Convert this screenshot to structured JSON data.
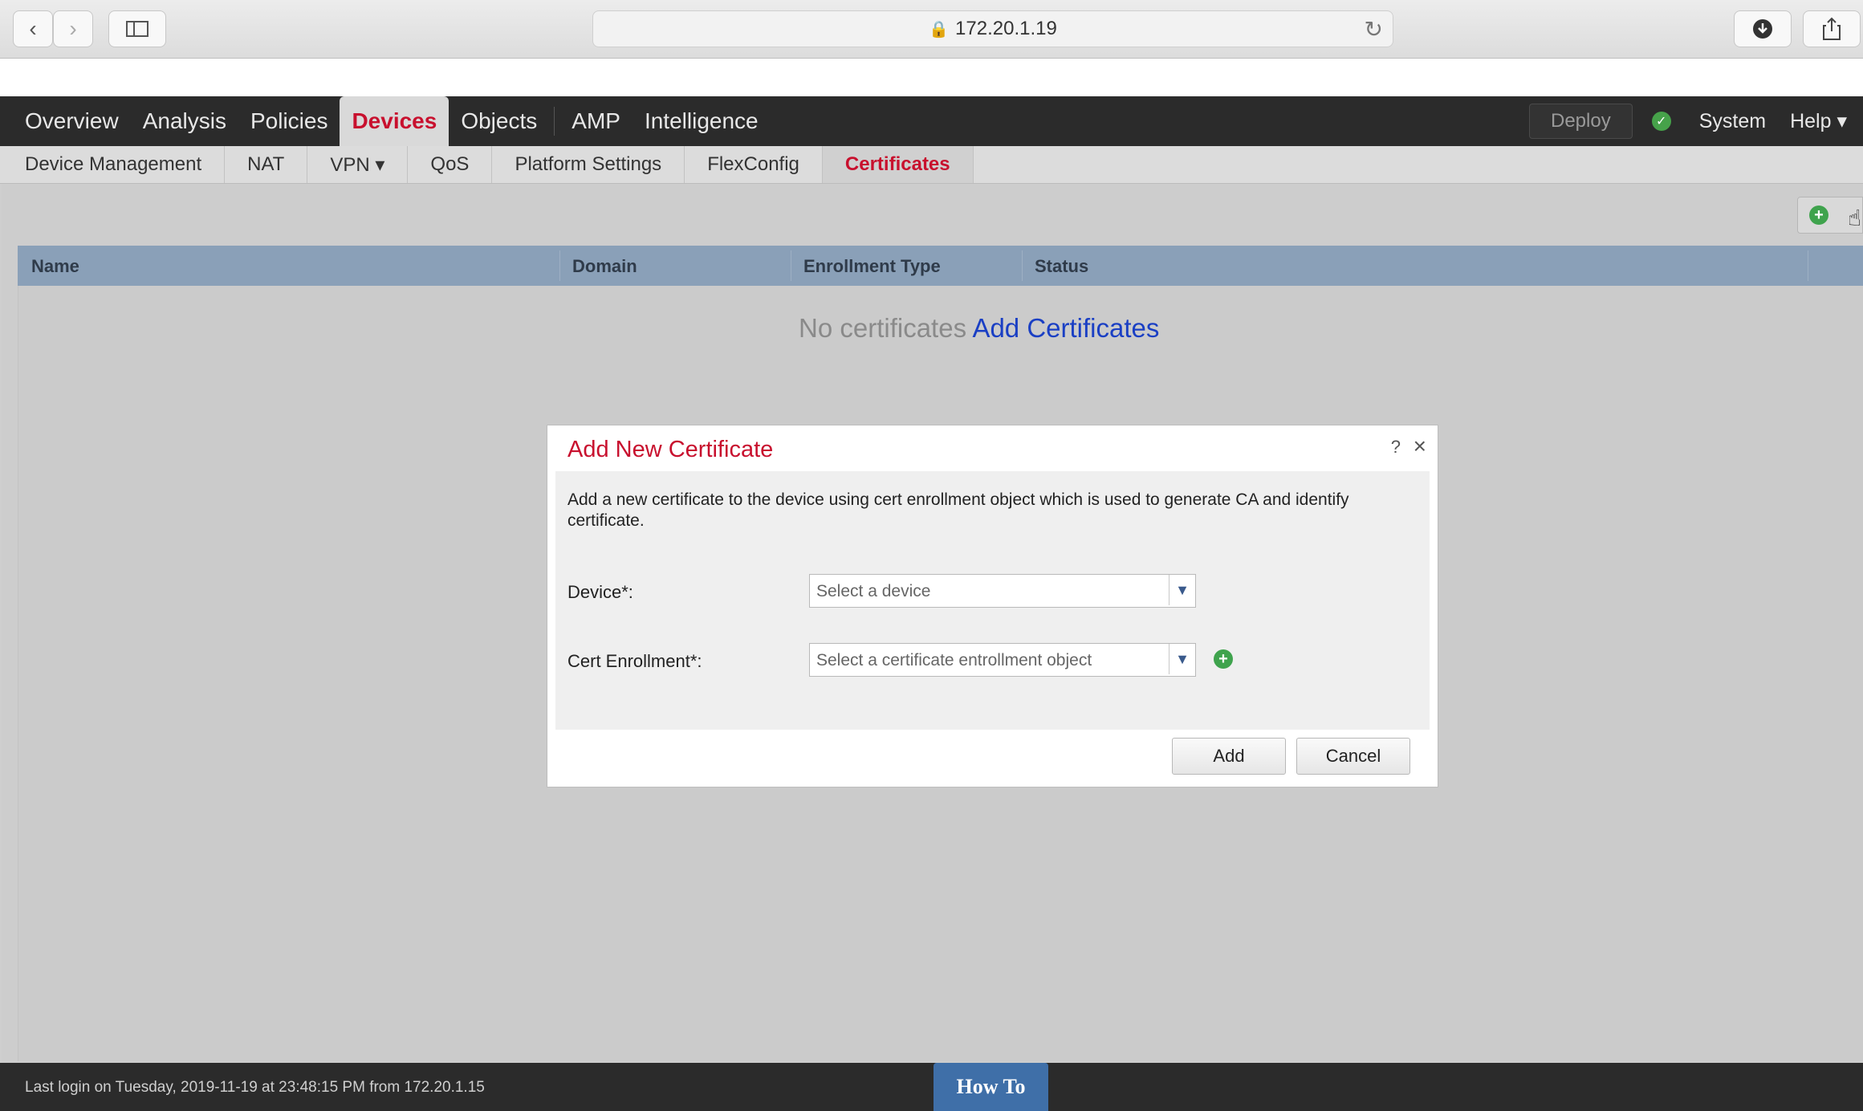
{
  "browser": {
    "url": "172.20.1.19"
  },
  "main_nav": {
    "items": [
      "Overview",
      "Analysis",
      "Policies",
      "Devices",
      "Objects",
      "AMP",
      "Intelligence"
    ],
    "active": "Devices",
    "deploy_label": "Deploy",
    "system_label": "System",
    "help_label": "Help ▾"
  },
  "sub_nav": {
    "items": [
      "Device Management",
      "NAT",
      "VPN ▾",
      "QoS",
      "Platform Settings",
      "FlexConfig",
      "Certificates"
    ],
    "active": "Certificates"
  },
  "table": {
    "columns": [
      "Name",
      "Domain",
      "Enrollment Type",
      "Status"
    ],
    "empty_text": "No certificates",
    "empty_link": "Add Certificates"
  },
  "modal": {
    "title": "Add New Certificate",
    "help": "?",
    "close": "×",
    "description": "Add a new certificate to the device using cert enrollment object which is used to generate CA and identify certificate.",
    "device_label": "Device*:",
    "device_placeholder": "Select a device",
    "cert_label": "Cert Enrollment*:",
    "cert_placeholder": "Select a certificate entrollment object",
    "add_button": "Add",
    "cancel_button": "Cancel"
  },
  "footer": {
    "last_login": "Last login on Tuesday, 2019-11-19 at 23:48:15 PM from 172.20.1.15",
    "howto": "How To"
  },
  "colors": {
    "accent_red": "#c8102e",
    "nav_bg": "#2b2b2b",
    "table_header": "#8aa0b8",
    "link_blue": "#1a3fc4",
    "status_green": "#46a24a"
  }
}
